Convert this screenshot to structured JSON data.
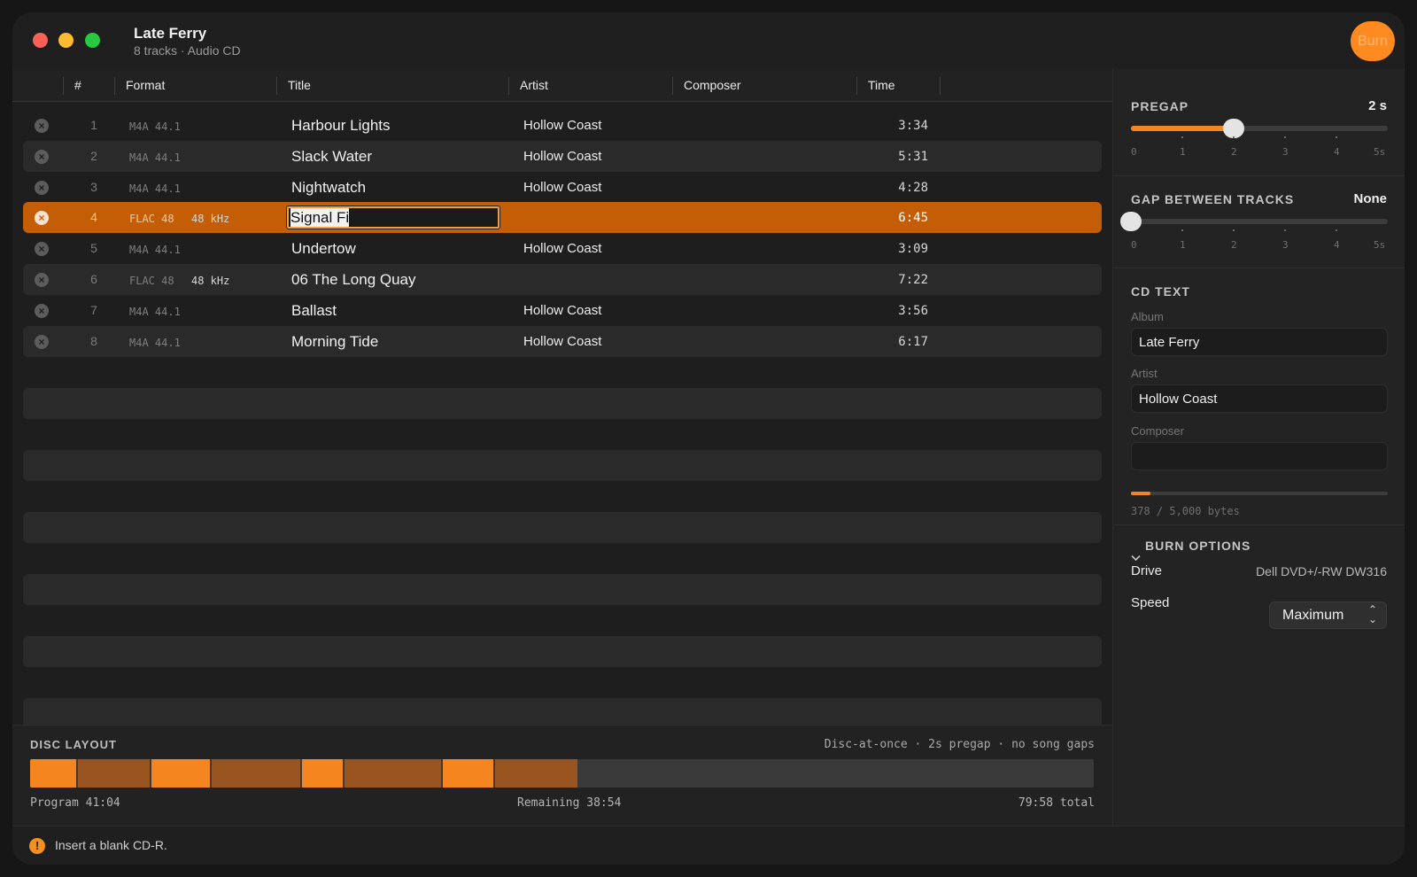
{
  "window": {
    "title": "Late Ferry",
    "subtitle": "8 tracks · Audio CD",
    "burn_label": "Burn"
  },
  "columns": [
    "#",
    "Format",
    "Title",
    "Artist",
    "Composer",
    "Time"
  ],
  "tracks": [
    {
      "num": "1",
      "format": "M4A 44.1",
      "rate": "",
      "title": "Harbour Lights",
      "artist": "Hollow Coast",
      "composer": "",
      "time": "3:34"
    },
    {
      "num": "2",
      "format": "M4A 44.1",
      "rate": "",
      "title": "Slack Water",
      "artist": "Hollow Coast",
      "composer": "",
      "time": "5:31"
    },
    {
      "num": "3",
      "format": "M4A 44.1",
      "rate": "",
      "title": "Nightwatch",
      "artist": "Hollow Coast",
      "composer": "",
      "time": "4:28"
    },
    {
      "num": "4",
      "format": "FLAC 48",
      "rate": "48 kHz",
      "title": "Signal Fi",
      "artist": "",
      "composer": "",
      "time": "6:45",
      "selected": true,
      "editing": true
    },
    {
      "num": "5",
      "format": "M4A 44.1",
      "rate": "",
      "title": "Undertow",
      "artist": "Hollow Coast",
      "composer": "",
      "time": "3:09"
    },
    {
      "num": "6",
      "format": "FLAC 48",
      "rate": "48 kHz",
      "title": "06 The Long Quay",
      "artist": "",
      "composer": "",
      "time": "7:22"
    },
    {
      "num": "7",
      "format": "M4A 44.1",
      "rate": "",
      "title": "Ballast",
      "artist": "Hollow Coast",
      "composer": "",
      "time": "3:56"
    },
    {
      "num": "8",
      "format": "M4A 44.1",
      "rate": "",
      "title": "Morning Tide",
      "artist": "Hollow Coast",
      "composer": "",
      "time": "6:17"
    }
  ],
  "disc": {
    "label": "DISC LAYOUT",
    "mode": "Disc-at-once · 2s pregap · no song gaps",
    "program": "Program 41:04",
    "remaining": "Remaining 38:54",
    "total": "79:58 total",
    "capacity_seconds": 4798,
    "segment_seconds": [
      216,
      333,
      270,
      407,
      191,
      444,
      238,
      379
    ]
  },
  "status": {
    "icon": "warning-icon",
    "text": "Insert a blank CD-R."
  },
  "sidebar": {
    "pregap": {
      "label": "PREGAP",
      "value": "2 s",
      "level": 2,
      "max": 5
    },
    "gap": {
      "label": "GAP BETWEEN TRACKS",
      "value": "None",
      "level": 0,
      "max": 5
    },
    "tick_labels": [
      "0",
      "1",
      "2",
      "3",
      "4",
      "5s"
    ],
    "cd_text": {
      "label": "CD TEXT",
      "album_label": "Album",
      "album_value": "Late Ferry",
      "artist_label": "Artist",
      "artist_value": "Hollow Coast",
      "composer_label": "Composer",
      "composer_value": "",
      "bytes_used": 378,
      "bytes_max": 5000,
      "bytes_text": "378 / 5,000 bytes"
    },
    "burn_options": {
      "label": "BURN OPTIONS",
      "drive_label": "Drive",
      "drive_value": "Dell DVD+/-RW DW316",
      "speed_label": "Speed",
      "speed_value": "Maximum"
    }
  },
  "colors": {
    "accent": "#f5861f",
    "selection": "#c45e06",
    "segment_dark": "#9a5420"
  }
}
